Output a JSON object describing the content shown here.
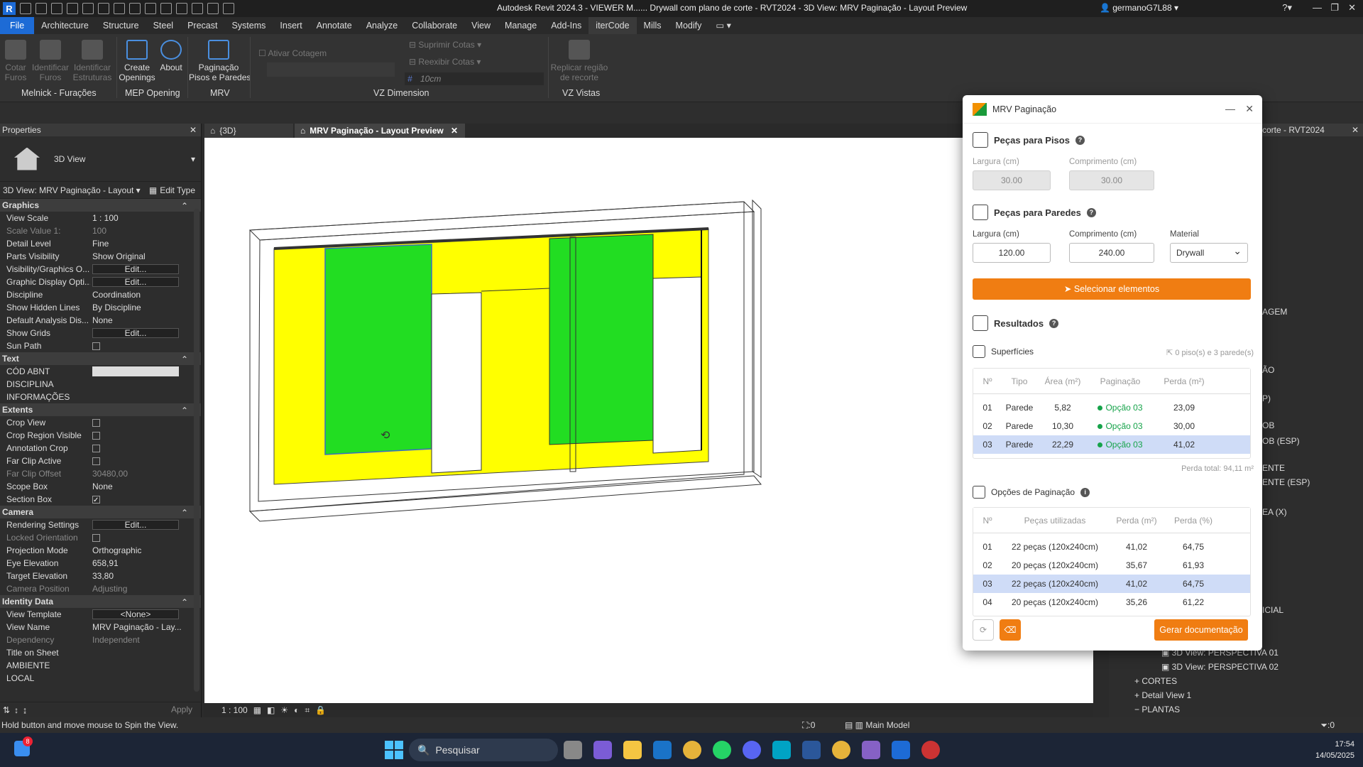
{
  "titlebar": {
    "title": "Autodesk Revit 2024.3 - VIEWER M...... Drywall com plano de corte - RVT2024 - 3D View: MRV Paginação - Layout Preview",
    "user": "germanoG7L88"
  },
  "menu": [
    "File",
    "Architecture",
    "Structure",
    "Steel",
    "Precast",
    "Systems",
    "Insert",
    "Annotate",
    "Analyze",
    "Collaborate",
    "View",
    "Manage",
    "Add-Ins",
    "iterCode",
    "Mills",
    "Modify"
  ],
  "ribbon": {
    "btn_cotar": "Cotar\nFuros",
    "btn_identificar_furos": "Identificar\nFuros",
    "btn_identificar_estruturas": "Identificar\nEstruturas",
    "btn_create_openings": "Create\nOpenings",
    "btn_about": "About",
    "btn_paginacao": "Paginação\nPisos e Paredes",
    "ativar_cotagem": "Ativar Cotagem",
    "suprimir_cotas": "Suprimir Cotas",
    "reexibir_cotas": "Reexibir Cotas",
    "offset_value": "10cm",
    "btn_replicar": "Replicar região\nde recorte",
    "group_melnick": "Melnick - Furações",
    "group_mep": "MEP Opening",
    "group_mrv": "MRV",
    "group_vz_dimension": "VZ Dimension",
    "group_vz_vistas": "VZ Vistas"
  },
  "properties": {
    "header": "Properties",
    "type_name": "3D View",
    "view_selector": "3D View: MRV Paginação - Layout",
    "edit_type": "Edit Type",
    "apply": "Apply",
    "groups": {
      "graphics": "Graphics",
      "text": "Text",
      "extents": "Extents",
      "camera": "Camera",
      "identity": "Identity Data"
    },
    "graphics_rows": [
      {
        "k": "View Scale",
        "v": "1 : 100"
      },
      {
        "k": "Scale Value    1:",
        "v": "100"
      },
      {
        "k": "Detail Level",
        "v": "Fine"
      },
      {
        "k": "Parts Visibility",
        "v": "Show Original"
      },
      {
        "k": "Visibility/Graphics O...",
        "v": "Edit..."
      },
      {
        "k": "Graphic Display Opti...",
        "v": "Edit..."
      },
      {
        "k": "Discipline",
        "v": "Coordination"
      },
      {
        "k": "Show Hidden Lines",
        "v": "By Discipline"
      },
      {
        "k": "Default Analysis Dis...",
        "v": "None"
      },
      {
        "k": "Show Grids",
        "v": "Edit..."
      },
      {
        "k": "Sun Path",
        "v": ""
      }
    ],
    "text_rows": [
      {
        "k": "CÓD ABNT",
        "v": ""
      },
      {
        "k": "DISCIPLINA",
        "v": ""
      },
      {
        "k": "INFORMAÇÕES",
        "v": ""
      }
    ],
    "extents_rows": [
      {
        "k": "Crop View",
        "v": ""
      },
      {
        "k": "Crop Region Visible",
        "v": ""
      },
      {
        "k": "Annotation Crop",
        "v": ""
      },
      {
        "k": "Far Clip Active",
        "v": ""
      },
      {
        "k": "Far Clip Offset",
        "v": "30480,00"
      },
      {
        "k": "Scope Box",
        "v": "None"
      },
      {
        "k": "Section Box",
        "v": ""
      }
    ],
    "camera_rows": [
      {
        "k": "Rendering Settings",
        "v": "Edit..."
      },
      {
        "k": "Locked Orientation",
        "v": ""
      },
      {
        "k": "Projection Mode",
        "v": "Orthographic"
      },
      {
        "k": "Eye Elevation",
        "v": "658,91"
      },
      {
        "k": "Target Elevation",
        "v": "33,80"
      },
      {
        "k": "Camera Position",
        "v": "Adjusting"
      }
    ],
    "identity_rows": [
      {
        "k": "View Template",
        "v": "<None>"
      },
      {
        "k": "View Name",
        "v": "MRV Paginação - Lay..."
      },
      {
        "k": "Dependency",
        "v": "Independent"
      },
      {
        "k": "Title on Sheet",
        "v": ""
      },
      {
        "k": "AMBIENTE",
        "v": ""
      },
      {
        "k": "LOCAL",
        "v": ""
      }
    ]
  },
  "tabs": {
    "tab1": "{3D}",
    "tab2": "MRV Paginação - Layout Preview"
  },
  "viewbar": {
    "scale": "1 : 100"
  },
  "browser": {
    "header": "corte - RVT2024",
    "items": {
      "agem": "AGEM",
      "ao": "ÃO",
      "p": "P)",
      "ob": "OB",
      "ob_esp": "OB (ESP)",
      "ente": "ENTE",
      "ente_esp": "ENTE (ESP)",
      "ea_x": "EA (X)",
      "icial": "ICIAL",
      "persp1": "3D View: PERSPECTIVA 01",
      "persp2": "3D View: PERSPECTIVA 02",
      "cortes": "CORTES",
      "detail": "Detail View 1",
      "plantas": "PLANTAS"
    }
  },
  "statusbar": {
    "hint": "Hold button and move mouse to Spin the View.",
    "count": ":0",
    "model": "Main Model",
    "filter": ":0"
  },
  "taskbar": {
    "search": "Pesquisar",
    "time": "17:54",
    "date": "14/05/2025",
    "badge": "8"
  },
  "dialog": {
    "title": "MRV Paginação",
    "pisos_title": "Peças para Pisos",
    "pisos_largura_label": "Largura (cm)",
    "pisos_comprimento_label": "Comprimento (cm)",
    "pisos_largura": "30.00",
    "pisos_comprimento": "30.00",
    "paredes_title": "Peças para Paredes",
    "paredes_largura_label": "Largura (cm)",
    "paredes_comprimento_label": "Comprimento (cm)",
    "paredes_material_label": "Material",
    "paredes_largura": "120.00",
    "paredes_comprimento": "240.00",
    "paredes_material": "Drywall",
    "select_button": "Selecionar elementos",
    "resultados_title": "Resultados",
    "superficies_title": "Superfícies",
    "superficies_count": "0 piso(s) e 3 parede(s)",
    "surf_headers": [
      "Nº",
      "Tipo",
      "Área (m²)",
      "Paginação",
      "Perda (m²)"
    ],
    "surf_rows": [
      {
        "n": "01",
        "tipo": "Parede",
        "area": "5,82",
        "pag": "Opção 03",
        "perda": "23,09"
      },
      {
        "n": "02",
        "tipo": "Parede",
        "area": "10,30",
        "pag": "Opção 03",
        "perda": "30,00"
      },
      {
        "n": "03",
        "tipo": "Parede",
        "area": "22,29",
        "pag": "Opção 03",
        "perda": "41,02"
      }
    ],
    "perda_total": "Perda total: 94,11 m²",
    "opcoes_title": "Opções de Paginação",
    "opt_headers": [
      "Nº",
      "Peças utilizadas",
      "Perda (m²)",
      "Perda (%)"
    ],
    "opt_rows": [
      {
        "n": "01",
        "pecas": "22 peças (120x240cm)",
        "perda": "41,02",
        "pct": "64,75"
      },
      {
        "n": "02",
        "pecas": "20 peças (120x240cm)",
        "perda": "35,67",
        "pct": "61,93"
      },
      {
        "n": "03",
        "pecas": "22 peças (120x240cm)",
        "perda": "41,02",
        "pct": "64,75"
      },
      {
        "n": "04",
        "pecas": "20 peças (120x240cm)",
        "perda": "35,26",
        "pct": "61,22"
      }
    ],
    "gerar_button": "Gerar documentação"
  },
  "colors": {
    "accent_orange": "#f07d12",
    "revit_blue": "#1d6bd6",
    "panel_green": "#22dd22",
    "panel_yellow": "#ffff00",
    "selected_row": "#cfdcf7"
  }
}
